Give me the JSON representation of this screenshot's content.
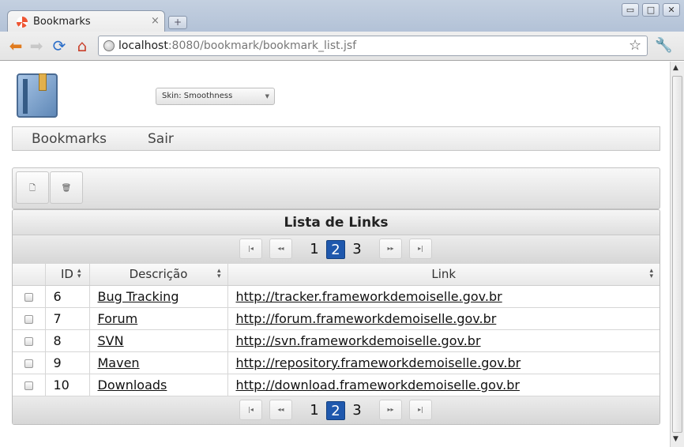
{
  "browser": {
    "tab_title": "Bookmarks",
    "tab_close": "×",
    "new_tab": "+",
    "url_host": "localhost",
    "url_rest": ":8080/bookmark/bookmark_list.jsf",
    "window_buttons": [
      "▭",
      "□",
      "✕"
    ]
  },
  "app": {
    "skin_select": "Skin: Smoothness",
    "menu": [
      "Bookmarks",
      "Sair"
    ],
    "panel_title": "Lista de Links",
    "pager": {
      "first": "|◂",
      "prev": "◂◂",
      "pages": [
        "1",
        "2",
        "3"
      ],
      "current_page": "2",
      "next": "▸▸",
      "last": "▸|"
    },
    "columns": [
      "ID",
      "Descrição",
      "Link"
    ],
    "rows": [
      {
        "id": "6",
        "descricao": "Bug Tracking",
        "link": "http://tracker.frameworkdemoiselle.gov.br"
      },
      {
        "id": "7",
        "descricao": "Forum",
        "link": "http://forum.frameworkdemoiselle.gov.br"
      },
      {
        "id": "8",
        "descricao": "SVN",
        "link": "http://svn.frameworkdemoiselle.gov.br"
      },
      {
        "id": "9",
        "descricao": "Maven",
        "link": "http://repository.frameworkdemoiselle.gov.br"
      },
      {
        "id": "10",
        "descricao": "Downloads",
        "link": "http://download.frameworkdemoiselle.gov.br"
      }
    ]
  },
  "colors": {
    "accent": "#1f58ad",
    "chrome": "#b3c2d7"
  }
}
